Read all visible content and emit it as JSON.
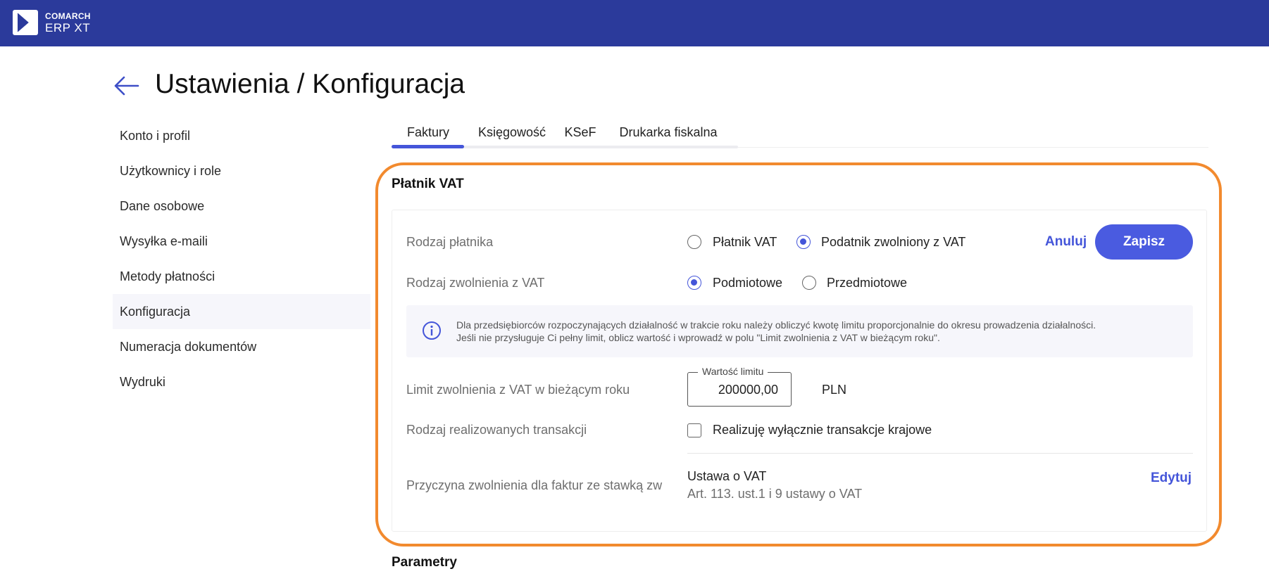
{
  "header": {
    "brand_top": "COMARCH",
    "brand_bottom": "ERP XT",
    "brand_color": "#2b3a9b"
  },
  "page": {
    "title": "Ustawienia / Konfiguracja",
    "back_icon": "arrow-left-icon"
  },
  "sidebar": {
    "items": [
      {
        "label": "Konto i profil"
      },
      {
        "label": "Użytkownicy i role"
      },
      {
        "label": "Dane osobowe"
      },
      {
        "label": "Wysyłka e-maili"
      },
      {
        "label": "Metody płatności"
      },
      {
        "label": "Konfiguracja",
        "active": true
      },
      {
        "label": "Numeracja dokumentów"
      },
      {
        "label": "Wydruki"
      }
    ]
  },
  "tabs": [
    {
      "label": "Faktury",
      "active": true
    },
    {
      "label": "Księgowość"
    },
    {
      "label": "KSeF"
    },
    {
      "label": "Drukarka fiskalna"
    }
  ],
  "vat_section": {
    "title": "Płatnik VAT",
    "payer_type": {
      "label": "Rodzaj płatnika",
      "options": [
        {
          "label": "Płatnik VAT",
          "checked": false
        },
        {
          "label": "Podatnik zwolniony z VAT",
          "checked": true
        }
      ]
    },
    "cancel_label": "Anuluj",
    "save_label": "Zapisz",
    "exemption_type": {
      "label": "Rodzaj zwolnienia z VAT",
      "options": [
        {
          "label": "Podmiotowe",
          "checked": true
        },
        {
          "label": "Przedmiotowe",
          "checked": false
        }
      ]
    },
    "info": {
      "icon": "info-icon",
      "line1": "Dla przedsiębiorców rozpoczynających działalność w trakcie roku należy obliczyć kwotę limitu proporcjonalnie do okresu prowadzenia działalności.",
      "line2": "Jeśli nie przysługuje Ci pełny limit, oblicz wartość i wprowadź w polu \"Limit zwolnienia z VAT w bieżącym roku\"."
    },
    "limit": {
      "label": "Limit zwolnienia z VAT w bieżącym roku",
      "field_legend": "Wartość limitu",
      "value": "200000,00",
      "currency": "PLN"
    },
    "transactions": {
      "label": "Rodzaj realizowanych transakcji",
      "checkbox_label": "Realizuję wyłącznie transakcje krajowe",
      "checked": false
    },
    "reason": {
      "label": "Przyczyna zwolnienia dla faktur ze stawką zw",
      "title": "Ustawa o VAT",
      "subtitle": "Art. 113. ust.1 i 9 ustawy o VAT",
      "edit_label": "Edytuj"
    }
  },
  "next_section": {
    "title": "Parametry"
  },
  "colors": {
    "accent": "#4455d9",
    "highlight": "#f28a2e"
  }
}
